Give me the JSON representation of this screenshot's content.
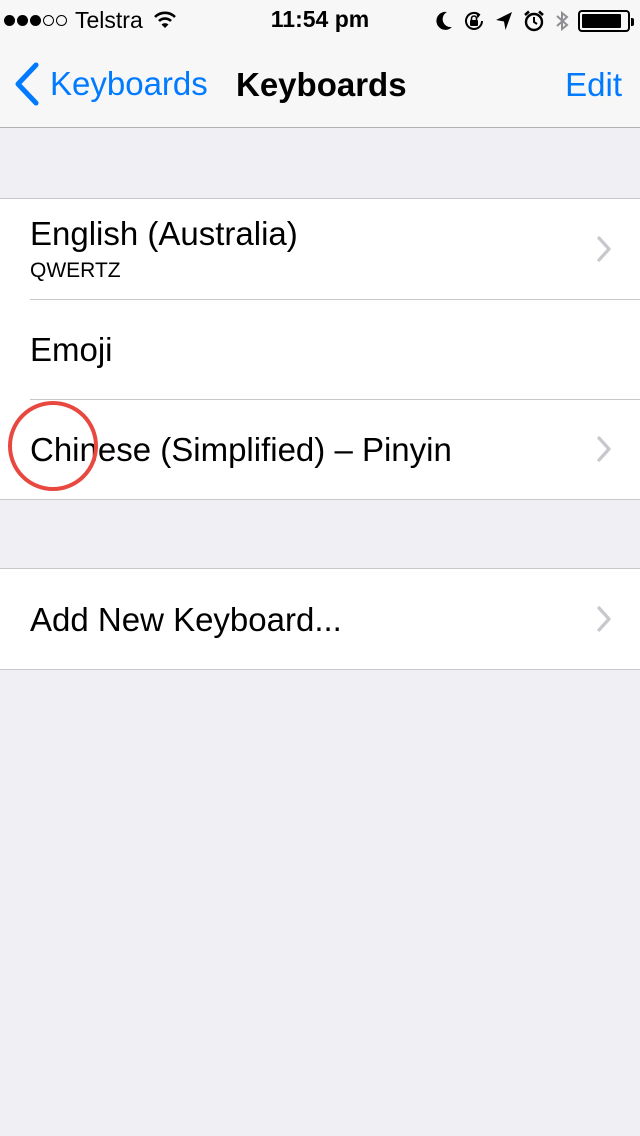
{
  "status_bar": {
    "signal": {
      "filled": 3,
      "total": 5
    },
    "carrier": "Telstra",
    "time": "11:54 pm",
    "icons": [
      "wifi-icon",
      "moon-icon",
      "rotation-lock-icon",
      "location-icon",
      "alarm-icon",
      "bluetooth-icon",
      "battery-icon"
    ],
    "battery_level": 0.88
  },
  "nav": {
    "back_label": "Keyboards",
    "title": "Keyboards",
    "edit_label": "Edit"
  },
  "keyboards": [
    {
      "title": "English (Australia)",
      "subtitle": "QWERTZ",
      "has_chevron": true
    },
    {
      "title": "Emoji",
      "has_chevron": false
    },
    {
      "title": "Chinese (Simplified) – Pinyin",
      "has_chevron": true
    }
  ],
  "add_keyboard": {
    "title": "Add New Keyboard...",
    "has_chevron": true
  },
  "colors": {
    "accent": "#007aff",
    "background": "#efeff4",
    "separator": "#c8c7cc",
    "annotation": "#e8483f",
    "chevron": "#c7c7cc"
  }
}
